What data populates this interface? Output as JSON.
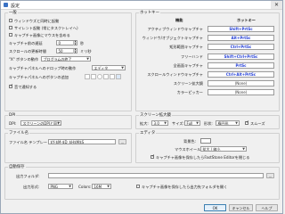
{
  "window": {
    "title": "設定",
    "close": "✕"
  },
  "general": {
    "legend": "一般",
    "startup": "ウィンドウズと同時に起動",
    "silent": "サイレント起動 (常にタスクトレイへ)",
    "mouse_follow": "キャプチャ画像にマウスを含める",
    "delay_label": "キャプチャ前の遅延",
    "delay_value": "0",
    "delay_unit": "秒",
    "scroll_delay_label": "スクロールの更新時間",
    "scroll_delay_value": "50",
    "scroll_delay_unit": "ミリ秒",
    "x_button_label": "\"X\" ボタンの動作",
    "x_button_value": "プログラムの終了",
    "drag_label": "キャプチャパネルへのドロップ時の動作",
    "drag_value": "エディタ",
    "tools_label": "キャプチャパネルへのボタンの追加",
    "sound": "音で通知する"
  },
  "hotkeys": {
    "legend": "ホットキー",
    "col_function": "機能",
    "col_hotkey": "ホットキー",
    "rows": [
      {
        "label": "アクティブウィンドウキャプチャ",
        "value": "Shift+PrtSc",
        "set": true
      },
      {
        "label": "ウィンドウ/オブジェクトキャプチャ",
        "value": "Alt+PrtSc",
        "set": true
      },
      {
        "label": "矩形範囲キャプチャ",
        "value": "Ctrl+PrtSc",
        "set": true
      },
      {
        "label": "フリーハンド",
        "value": "Shift+Ctrl+PrtSc",
        "set": true
      },
      {
        "label": "全画面キャプチャ",
        "value": "PrtSc",
        "set": true
      },
      {
        "label": "スクロールウィンドウキャプチャ",
        "value": "Ctrl+Alt+PrtSc",
        "set": true
      },
      {
        "label": "スクリーン拡大鏡",
        "value": "(None)",
        "set": false
      },
      {
        "label": "カラーピッカー",
        "value": "(None)",
        "set": false
      }
    ]
  },
  "dpi": {
    "legend": "DPI",
    "label": "DPI:",
    "value": "スクリーンのDPIと同じ"
  },
  "magnifier": {
    "legend": "スクリーン拡大鏡",
    "zoom_label": "拡大:",
    "zoom_value": "3.0",
    "size_label": "サイズ:",
    "size_value": "Full",
    "shape_label": "形状:",
    "shape_value": "楕円形",
    "smooth": "スムーズ"
  },
  "filename": {
    "legend": "ファイル名",
    "template_label": "ファイル名 テンプレート:",
    "template_value": "$Y-$M-$D_$H$M$S",
    "more_btn": "..."
  },
  "editor": {
    "legend": "エディタ",
    "bg_label": "背景色:",
    "mouse_label": "マウスホイール:",
    "mouse_value": "拡大 / 縮小",
    "after_capture": "キャプチャ画像を保存したらFastStone Editorを閉じる"
  },
  "autosave": {
    "legend": "自動保存",
    "folder_label": "出力フォルダ:",
    "format_label": "出力形式:",
    "format_value": "PNG",
    "colors_label": "Colors:",
    "colors_value": "16M",
    "open_folder": "キャプチャ画像を保存したら出力先フォルダを開く",
    "browse": "..."
  },
  "buttons": {
    "ok": "OK",
    "cancel": "キャンセル",
    "help": "ヘルプ"
  },
  "colors": {
    "hotkey_text": "#1f3bd6",
    "editor_bg_swatch": "#ffffff",
    "titlebar": "#ffffff"
  }
}
